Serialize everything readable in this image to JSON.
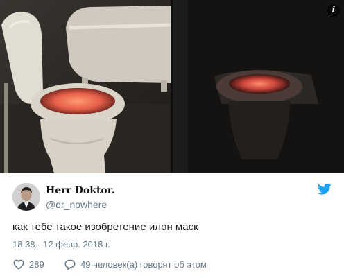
{
  "tweet": {
    "author": {
      "display_name": "Herr Doktor.",
      "handle": "@dr_nowhere"
    },
    "text": "как тебе такое изобретение илон маск",
    "timestamp": "18:38 - 12 февр. 2018 г.",
    "actions": {
      "likes_count": "289",
      "replies_label": "49 человек(а) говорят об этом"
    }
  },
  "icons": {
    "info": "info-icon",
    "brand": "twitter-bird-icon",
    "like": "heart-icon",
    "reply": "speech-bubble-icon"
  },
  "colors": {
    "twitter_blue": "#1da1f2",
    "secondary_text": "#657786",
    "primary_text": "#14171a",
    "glow": "#ff6a4a"
  }
}
